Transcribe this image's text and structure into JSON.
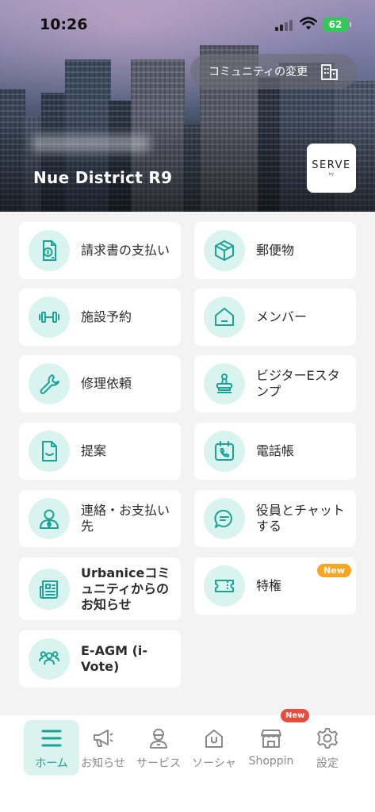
{
  "status_bar": {
    "time": "10:26",
    "battery": "62"
  },
  "header": {
    "community_change_label": "コミュニティの変更",
    "site_name": "Nue District R9",
    "logo_text": "SERVE",
    "logo_sub": "by"
  },
  "menu": {
    "items": [
      {
        "label": "請求書の支払い",
        "icon": "bill-icon"
      },
      {
        "label": "郵便物",
        "icon": "parcel-icon"
      },
      {
        "label": "施設予約",
        "icon": "dumbbell-icon"
      },
      {
        "label": "メンバー",
        "icon": "home-icon"
      },
      {
        "label": "修理依頼",
        "icon": "wrench-icon"
      },
      {
        "label": "ビジターEスタンプ",
        "icon": "stamp-icon"
      },
      {
        "label": "提案",
        "icon": "suggestion-icon"
      },
      {
        "label": "電話帳",
        "icon": "phone-book-icon"
      },
      {
        "label": "連絡・お支払い先",
        "icon": "contact-person-icon"
      },
      {
        "label": "役員とチャットする",
        "icon": "chat-icon"
      },
      {
        "label": "Urbaniceコミュニティからのお知らせ",
        "icon": "newspaper-icon"
      },
      {
        "label": "特権",
        "icon": "ticket-icon",
        "badge": "New"
      },
      {
        "label": "E-AGM (i-Vote)",
        "icon": "group-icon"
      }
    ]
  },
  "bottom_nav": {
    "items": [
      {
        "label": "ホーム",
        "icon": "menu-icon",
        "active": true
      },
      {
        "label": "お知らせ",
        "icon": "megaphone-icon"
      },
      {
        "label": "サービス",
        "icon": "service-person-icon"
      },
      {
        "label": "ソーシャ",
        "icon": "social-house-icon"
      },
      {
        "label": "Shoppin",
        "icon": "shop-icon",
        "badge": "New"
      },
      {
        "label": "設定",
        "icon": "gear-icon"
      }
    ]
  },
  "colors": {
    "accent": "#1aa396",
    "icon_bg": "#d9f3ef",
    "badge_orange": "#f5a623",
    "badge_red": "#e74c3c"
  }
}
